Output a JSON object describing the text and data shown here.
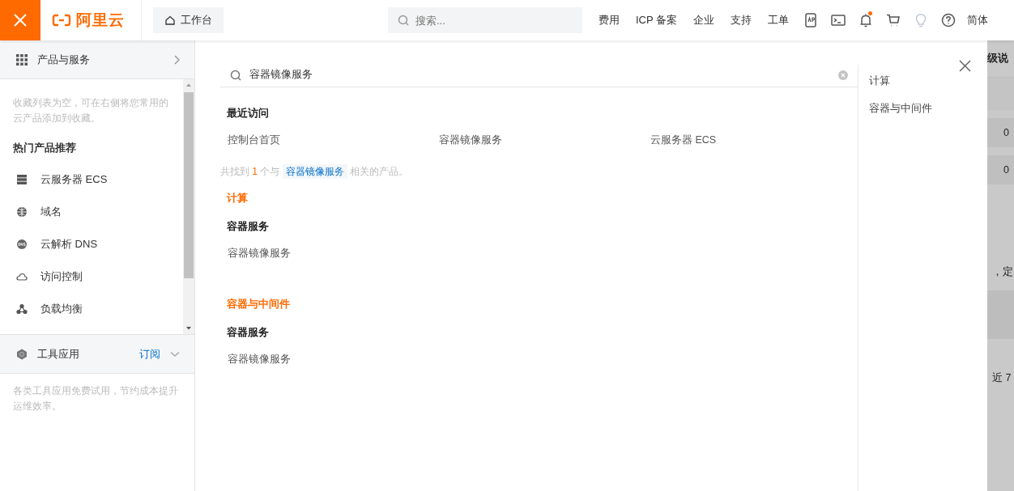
{
  "header": {
    "logo_text": "阿里云",
    "workbench": "工作台",
    "search": {
      "placeholder": "搜索..."
    },
    "nav_links": [
      "费用",
      "ICP 备案",
      "企业",
      "支持",
      "工单"
    ],
    "notifications_unread": true,
    "language": "简体"
  },
  "sidebar": {
    "products_label": "产品与服务",
    "favorites_hint": "收藏列表为空，可在右侧将您常用的云产品添加到收藏。",
    "hot_title": "热门产品推荐",
    "hot_products": [
      "云服务器 ECS",
      "域名",
      "云解析 DNS",
      "访问控制",
      "负载均衡"
    ],
    "tools": {
      "label": "工具应用",
      "subscribe": "订阅",
      "hint": "各类工具应用免费试用，节约成本提升运维效率。"
    }
  },
  "panel": {
    "query": "容器镜像服务",
    "recent_title": "最近访问",
    "recent": [
      "控制台首页",
      "容器镜像服务",
      "云服务器 ECS"
    ],
    "summary": {
      "prefix": "共找到",
      "count": "1",
      "middle": "个与",
      "keyword": "容器镜像服务",
      "suffix": "相关的产品。"
    },
    "groups": [
      {
        "category": "计算",
        "subgroups": [
          {
            "title": "容器服务",
            "items": [
              "容器镜像服务"
            ]
          }
        ]
      },
      {
        "category": "容器与中间件",
        "subgroups": [
          {
            "title": "容器服务",
            "items": [
              "容器镜像服务"
            ]
          }
        ]
      }
    ],
    "category_nav": [
      "计算",
      "容器与中间件"
    ]
  },
  "backdrop": {
    "texts": [
      "级说",
      "0",
      "0",
      "，定",
      "近 7"
    ]
  }
}
